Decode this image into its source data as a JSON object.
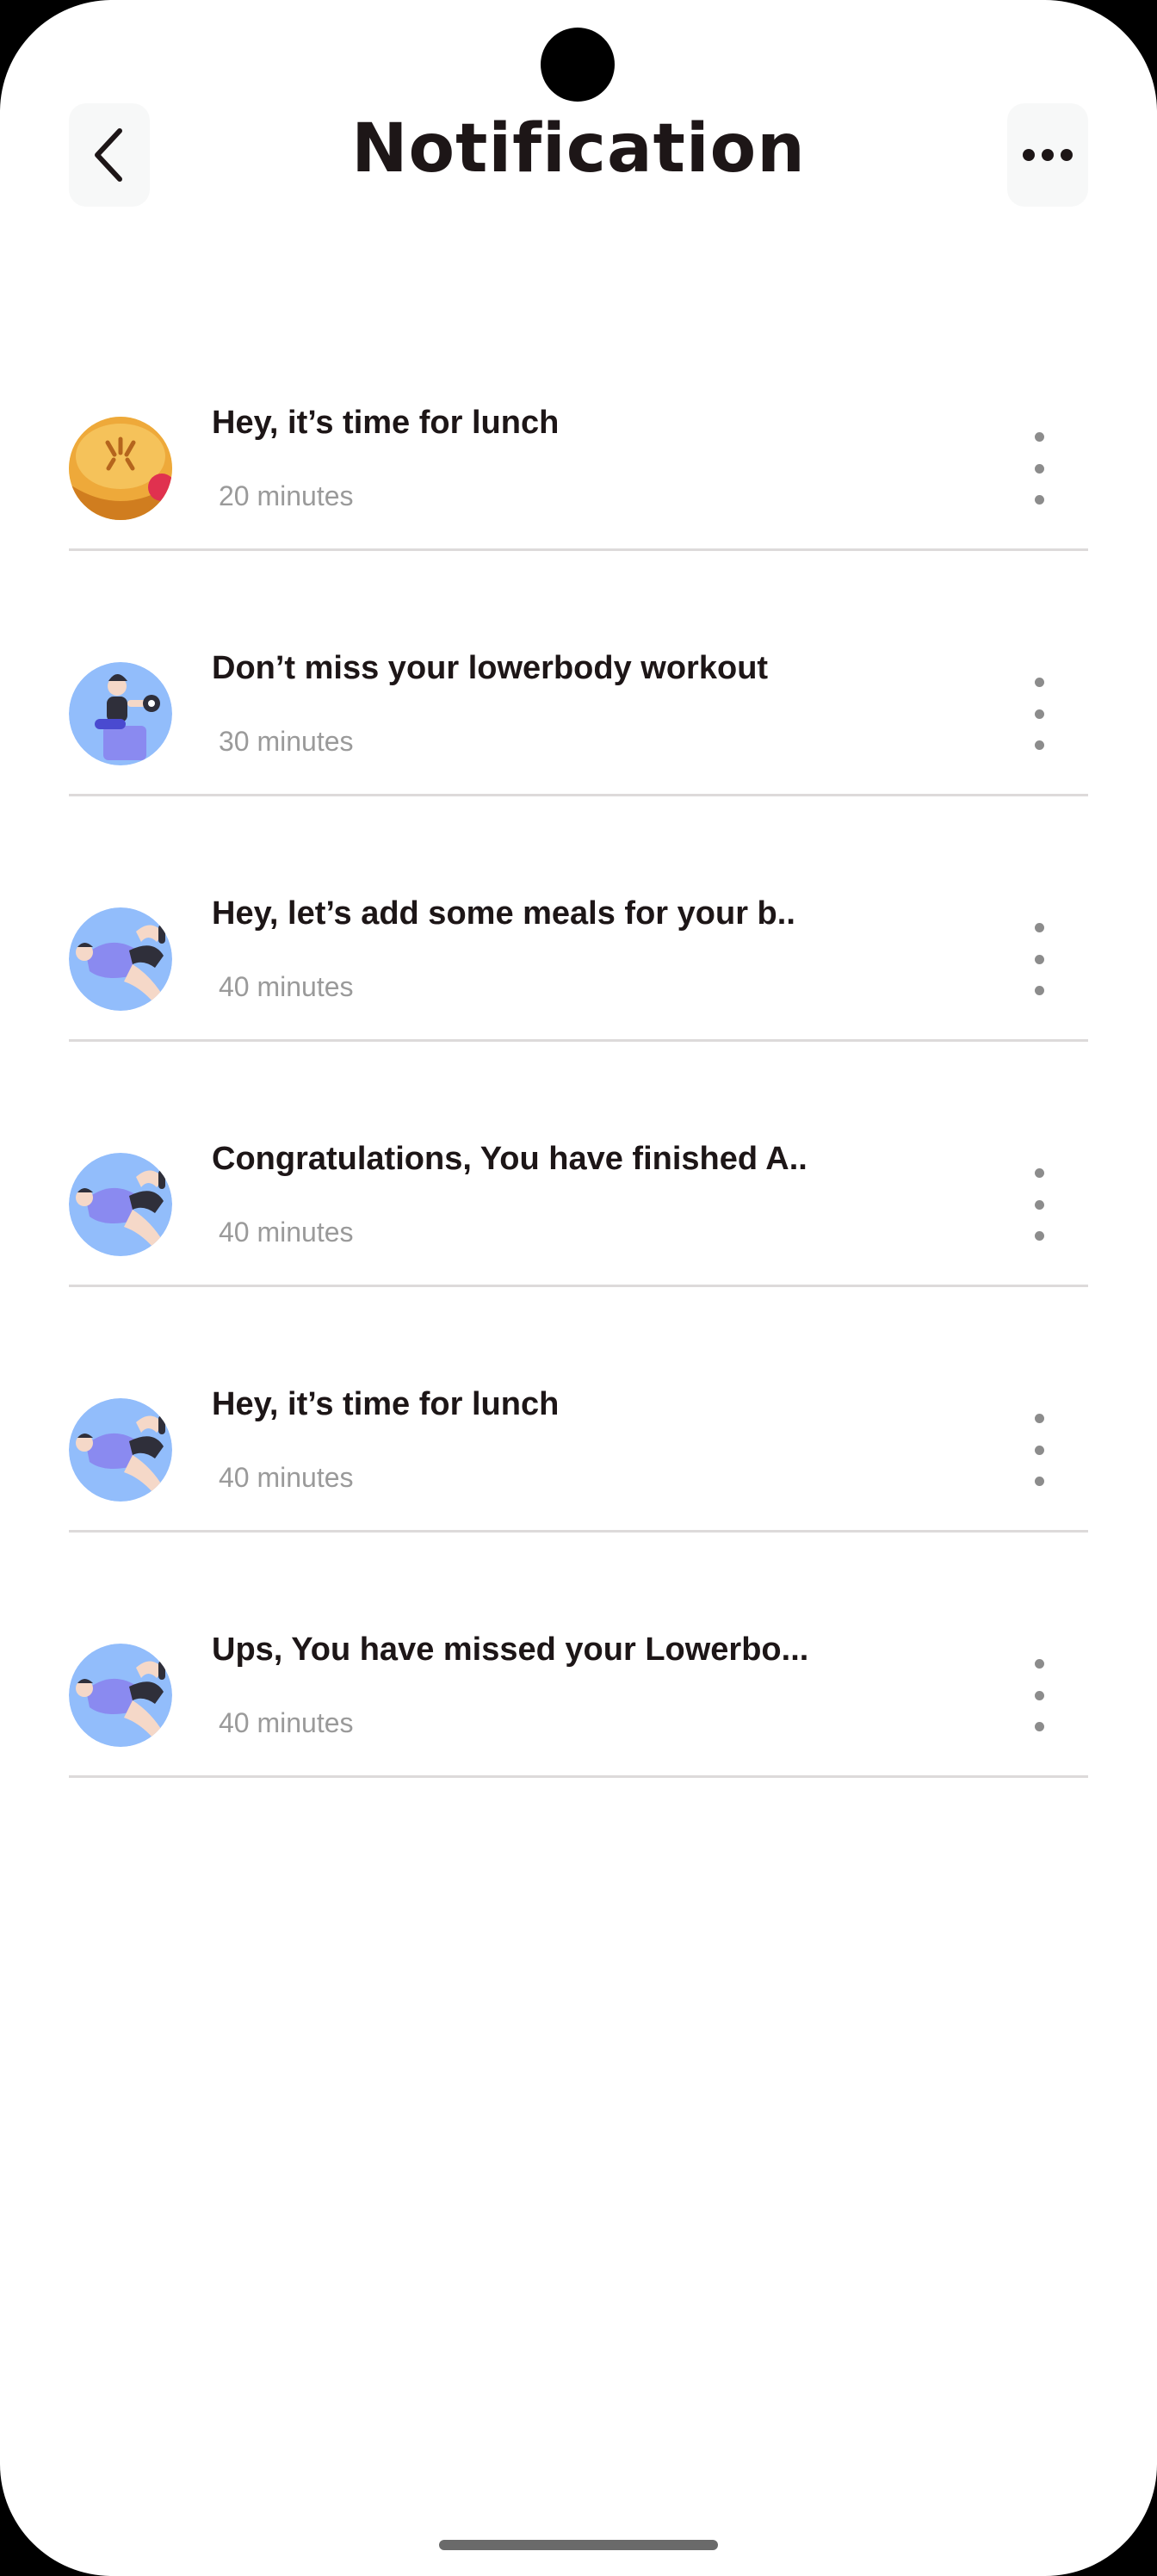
{
  "header": {
    "title": "Notification",
    "back_icon": "chevron-left-icon",
    "more_icon": "more-horizontal-icon"
  },
  "notifications": [
    {
      "title": "Hey, it’s time for lunch",
      "time": "20 minutes",
      "avatar": "lunch-pie"
    },
    {
      "title": "Don’t miss your lowerbody workout",
      "time": "30 minutes",
      "avatar": "workout-dumbbell"
    },
    {
      "title": "Hey, let’s add some meals for your b..",
      "time": "40 minutes",
      "avatar": "workout-stretch"
    },
    {
      "title": "Congratulations, You have finished A..",
      "time": "40 minutes",
      "avatar": "workout-stretch"
    },
    {
      "title": "Hey, it’s time for lunch",
      "time": "40 minutes",
      "avatar": "workout-stretch"
    },
    {
      "title": "Ups, You have missed your Lowerbo...",
      "time": "40 minutes",
      "avatar": "workout-stretch"
    }
  ],
  "colors": {
    "text_primary": "#1d1617",
    "text_secondary": "#9a9a9a",
    "avatar_bg": "#92bdfb",
    "button_bg": "#f7f8f8",
    "divider": "#dddada"
  }
}
